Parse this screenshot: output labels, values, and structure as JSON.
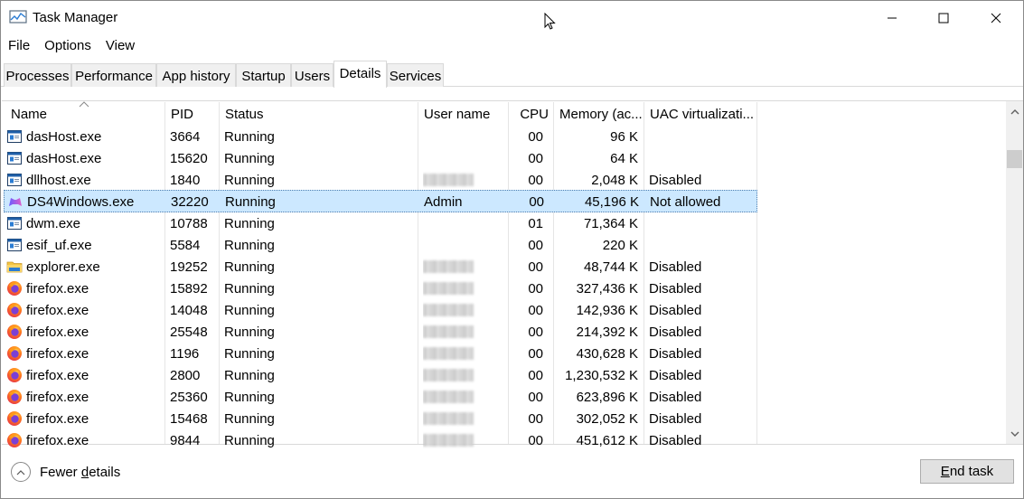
{
  "window": {
    "title": "Task Manager"
  },
  "menu": [
    "File",
    "Options",
    "View"
  ],
  "tabs": [
    "Processes",
    "Performance",
    "App history",
    "Startup",
    "Users",
    "Details",
    "Services"
  ],
  "active_tab": "Details",
  "columns": {
    "name": "Name",
    "pid": "PID",
    "status": "Status",
    "user": "User name",
    "cpu": "CPU",
    "memory": "Memory (ac...",
    "uac": "UAC virtualizati..."
  },
  "rows": [
    {
      "icon": "window-app-icon",
      "name": "dasHost.exe",
      "pid": "3664",
      "status": "Running",
      "user": "",
      "cpu": "00",
      "memory": "96 K",
      "uac": ""
    },
    {
      "icon": "window-app-icon",
      "name": "dasHost.exe",
      "pid": "15620",
      "status": "Running",
      "user": "",
      "cpu": "00",
      "memory": "64 K",
      "uac": ""
    },
    {
      "icon": "window-app-icon",
      "name": "dllhost.exe",
      "pid": "1840",
      "status": "Running",
      "user": "[blurred]",
      "cpu": "00",
      "memory": "2,048 K",
      "uac": "Disabled"
    },
    {
      "icon": "ds4windows-icon",
      "name": "DS4Windows.exe",
      "pid": "32220",
      "status": "Running",
      "user": "Admin",
      "cpu": "00",
      "memory": "45,196 K",
      "uac": "Not allowed",
      "selected": true
    },
    {
      "icon": "window-app-icon",
      "name": "dwm.exe",
      "pid": "10788",
      "status": "Running",
      "user": "",
      "cpu": "01",
      "memory": "71,364 K",
      "uac": ""
    },
    {
      "icon": "window-app-icon",
      "name": "esif_uf.exe",
      "pid": "5584",
      "status": "Running",
      "user": "",
      "cpu": "00",
      "memory": "220 K",
      "uac": ""
    },
    {
      "icon": "folder-icon",
      "name": "explorer.exe",
      "pid": "19252",
      "status": "Running",
      "user": "[blurred]",
      "cpu": "00",
      "memory": "48,744 K",
      "uac": "Disabled"
    },
    {
      "icon": "firefox-icon",
      "name": "firefox.exe",
      "pid": "15892",
      "status": "Running",
      "user": "[blurred]",
      "cpu": "00",
      "memory": "327,436 K",
      "uac": "Disabled"
    },
    {
      "icon": "firefox-icon",
      "name": "firefox.exe",
      "pid": "14048",
      "status": "Running",
      "user": "[blurred]",
      "cpu": "00",
      "memory": "142,936 K",
      "uac": "Disabled"
    },
    {
      "icon": "firefox-icon",
      "name": "firefox.exe",
      "pid": "25548",
      "status": "Running",
      "user": "[blurred]",
      "cpu": "00",
      "memory": "214,392 K",
      "uac": "Disabled"
    },
    {
      "icon": "firefox-icon",
      "name": "firefox.exe",
      "pid": "1196",
      "status": "Running",
      "user": "[blurred]",
      "cpu": "00",
      "memory": "430,628 K",
      "uac": "Disabled"
    },
    {
      "icon": "firefox-icon",
      "name": "firefox.exe",
      "pid": "2800",
      "status": "Running",
      "user": "[blurred]",
      "cpu": "00",
      "memory": "1,230,532 K",
      "uac": "Disabled"
    },
    {
      "icon": "firefox-icon",
      "name": "firefox.exe",
      "pid": "25360",
      "status": "Running",
      "user": "[blurred]",
      "cpu": "00",
      "memory": "623,896 K",
      "uac": "Disabled"
    },
    {
      "icon": "firefox-icon",
      "name": "firefox.exe",
      "pid": "15468",
      "status": "Running",
      "user": "[blurred]",
      "cpu": "00",
      "memory": "302,052 K",
      "uac": "Disabled"
    },
    {
      "icon": "firefox-icon",
      "name": "firefox.exe",
      "pid": "9844",
      "status": "Running",
      "user": "[blurred]",
      "cpu": "00",
      "memory": "451,612 K",
      "uac": "Disabled"
    }
  ],
  "footer": {
    "fewer_details_pre": "Fewer ",
    "fewer_details_u": "d",
    "fewer_details_post": "etails",
    "end_task_u": "E",
    "end_task_post": "nd task"
  },
  "colors": {
    "selection": "#cce8ff",
    "selection_border": "#4f7fb0",
    "button": "#e1e1e1"
  }
}
